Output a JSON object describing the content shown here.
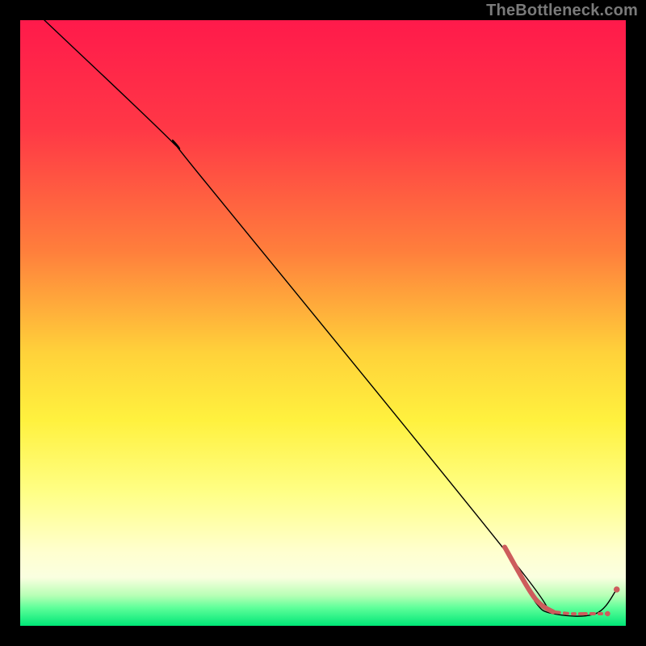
{
  "watermark": "TheBottleneck.com",
  "chart_data": {
    "type": "line",
    "title": "",
    "xlabel": "",
    "ylabel": "",
    "xlim": [
      0,
      100
    ],
    "ylim": [
      0,
      100
    ],
    "background_gradient": {
      "stops": [
        {
          "offset": 0,
          "color": "#ff1a4b"
        },
        {
          "offset": 18,
          "color": "#ff3846"
        },
        {
          "offset": 38,
          "color": "#ff7e3c"
        },
        {
          "offset": 55,
          "color": "#ffd23a"
        },
        {
          "offset": 66,
          "color": "#fff13e"
        },
        {
          "offset": 78,
          "color": "#ffff86"
        },
        {
          "offset": 88,
          "color": "#ffffd0"
        },
        {
          "offset": 92,
          "color": "#faffe0"
        },
        {
          "offset": 95,
          "color": "#b7ffb5"
        },
        {
          "offset": 97,
          "color": "#5fff9a"
        },
        {
          "offset": 100,
          "color": "#00e676"
        }
      ]
    },
    "series": [
      {
        "name": "main-curve",
        "color": "#000000",
        "stroke_width": 1.4,
        "points": [
          {
            "x": 4,
            "y": 100
          },
          {
            "x": 25,
            "y": 80
          },
          {
            "x": 30,
            "y": 74
          },
          {
            "x": 82,
            "y": 10
          },
          {
            "x": 85,
            "y": 4
          },
          {
            "x": 88,
            "y": 2
          },
          {
            "x": 95,
            "y": 2
          },
          {
            "x": 98.5,
            "y": 6
          }
        ]
      },
      {
        "name": "highlight-thick",
        "color": "#CD5C5C",
        "stroke_width": 6,
        "points": [
          {
            "x": 80,
            "y": 13
          },
          {
            "x": 84,
            "y": 6
          },
          {
            "x": 86,
            "y": 3.5
          },
          {
            "x": 88,
            "y": 2.3
          }
        ]
      },
      {
        "name": "highlight-dashed",
        "color": "#CD5C5C",
        "stroke_width": 4,
        "dash": "8 6 4 6 3 6",
        "points": [
          {
            "x": 88,
            "y": 2.3
          },
          {
            "x": 91,
            "y": 2.0
          },
          {
            "x": 94,
            "y": 2.0
          },
          {
            "x": 97,
            "y": 2.0
          }
        ]
      }
    ],
    "markers": [
      {
        "x": 97,
        "y": 2.0,
        "r": 3.2,
        "color": "#CD5C5C"
      },
      {
        "x": 98.5,
        "y": 6.0,
        "r": 3.8,
        "color": "#CD5C5C"
      }
    ]
  }
}
